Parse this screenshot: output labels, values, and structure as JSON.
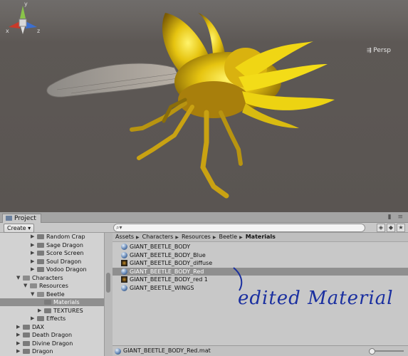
{
  "scene": {
    "persp_label": "Persp",
    "gizmo_axes": {
      "y": "y",
      "x": "x",
      "z": "z"
    }
  },
  "project": {
    "tab_label": "Project",
    "create_label": "Create",
    "tree": [
      {
        "label": "Random Crap",
        "level": 3,
        "expanded": false,
        "selected": false
      },
      {
        "label": "Sage Dragon",
        "level": 3,
        "expanded": false,
        "selected": false
      },
      {
        "label": "Score Screen",
        "level": 3,
        "expanded": false,
        "selected": false
      },
      {
        "label": "Soul Dragon",
        "level": 3,
        "expanded": false,
        "selected": false
      },
      {
        "label": "Vodoo Dragon",
        "level": 3,
        "expanded": false,
        "selected": false
      },
      {
        "label": "Characters",
        "level": 1,
        "expanded": true,
        "selected": false
      },
      {
        "label": "Resources",
        "level": 2,
        "expanded": true,
        "selected": false
      },
      {
        "label": "Beetle",
        "level": 3,
        "expanded": true,
        "selected": false
      },
      {
        "label": "Materials",
        "level": 4,
        "expanded": false,
        "selected": true
      },
      {
        "label": "TEXTURES",
        "level": 4,
        "expanded": false,
        "selected": false
      },
      {
        "label": "Effects",
        "level": 3,
        "expanded": false,
        "selected": false
      },
      {
        "label": "DAX",
        "level": 1,
        "expanded": false,
        "selected": false
      },
      {
        "label": "Death Dragon",
        "level": 1,
        "expanded": false,
        "selected": false
      },
      {
        "label": "Divine Dragon",
        "level": 1,
        "expanded": false,
        "selected": false
      },
      {
        "label": "Dragon",
        "level": 1,
        "expanded": false,
        "selected": false
      }
    ],
    "breadcrumb": [
      "Assets",
      "Characters",
      "Resources",
      "Beetle",
      "Materials"
    ],
    "items": [
      {
        "label": "GIANT_BEETLE_BODY",
        "kind": "material",
        "selected": false
      },
      {
        "label": "GIANT_BEETLE_BODY_Blue",
        "kind": "material",
        "selected": false
      },
      {
        "label": "GIANT_BEETLE_BODY_diffuse",
        "kind": "texture",
        "selected": false
      },
      {
        "label": "GIANT_BEETLE_BODY_Red",
        "kind": "material",
        "selected": true
      },
      {
        "label": "GIANT_BEETLE_BODY_red 1",
        "kind": "texture",
        "selected": false
      },
      {
        "label": "GIANT_BEETLE_WINGS",
        "kind": "material",
        "selected": false
      }
    ],
    "status_file": "GIANT_BEETLE_BODY_Red.mat",
    "zoom_fraction": 0.0
  },
  "annotation": {
    "text": "edited Material"
  },
  "colors": {
    "selection": "#8f8f8f",
    "annotation": "#1a2fa0",
    "beetle": "#e8c812"
  }
}
